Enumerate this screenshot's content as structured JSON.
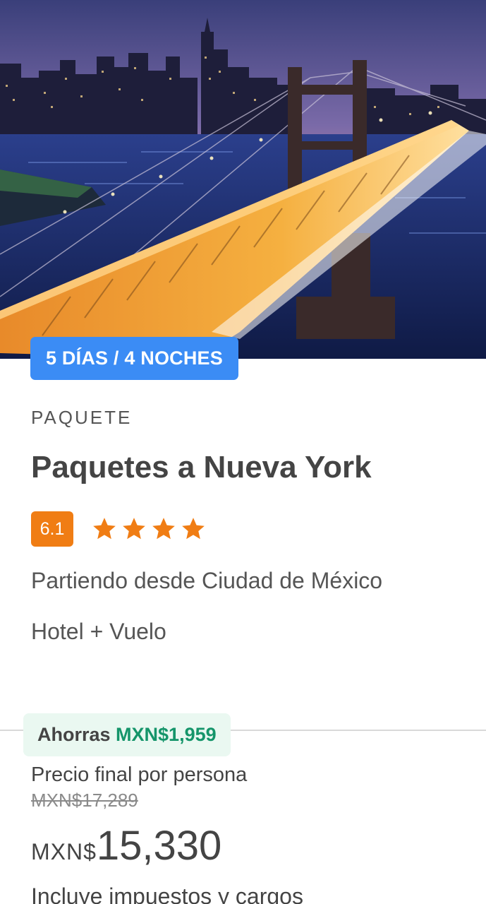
{
  "package": {
    "duration_label": "5 DÍAS / 4 NOCHES",
    "category": "PAQUETE",
    "title": "Paquetes a Nueva York",
    "rating_score": "6.1",
    "star_count": 4,
    "origin": "Partiendo desde Ciudad de México",
    "includes": "Hotel + Vuelo"
  },
  "pricing": {
    "savings_prefix": "Ahorras",
    "savings_amount": "MXN$1,959",
    "price_label": "Precio final por persona",
    "old_price": "MXN$17,289",
    "currency": "MXN$",
    "amount": "15,330",
    "tax_note": "Incluye impuestos y cargos"
  },
  "colors": {
    "duration_badge": "#3b8cf5",
    "rating_badge": "#f07d14",
    "star": "#f07d14",
    "savings_bg": "#eaf8f1",
    "savings_text": "#15956a"
  },
  "hero_image": {
    "icon": "city-bridge-night-photo"
  }
}
